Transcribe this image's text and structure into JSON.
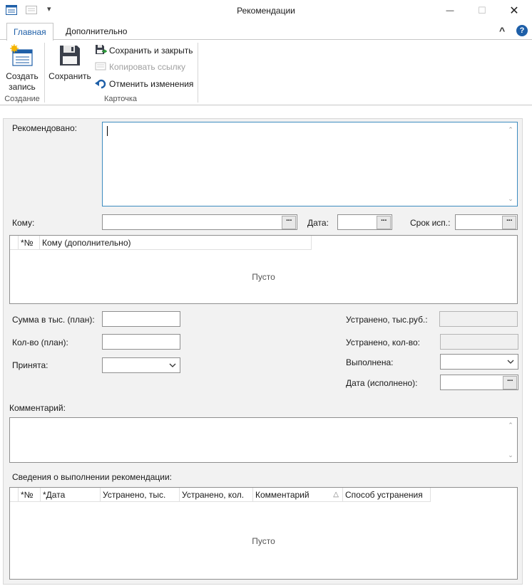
{
  "window": {
    "title": "Рекомендации",
    "minimize_glyph": "—",
    "maximize_glyph": "☐",
    "close_glyph": "✕",
    "qat_dropdown_glyph": "▾"
  },
  "ribbon": {
    "tabs": [
      {
        "label": "Главная",
        "active": true
      },
      {
        "label": "Дополнительно",
        "active": false
      }
    ],
    "collapse_glyph": "^",
    "help_glyph": "?",
    "groups": {
      "create": {
        "label": "Создание",
        "create_button": {
          "line1": "Создать",
          "line2": "запись"
        }
      },
      "card": {
        "label": "Карточка",
        "save_button": "Сохранить",
        "save_close": "Сохранить и закрыть",
        "copy_link": "Копировать ссылку",
        "undo_changes": "Отменить изменения"
      }
    }
  },
  "form": {
    "recommended_label": "Рекомендовано:",
    "recommended_value": "",
    "to_label": "Кому:",
    "to_value": "",
    "date_label": "Дата:",
    "date_value": "",
    "deadline_label": "Срок исп.:",
    "deadline_value": "",
    "dots_glyph": "···",
    "to_extra_grid": {
      "columns": [
        "*№",
        "Кому (дополнительно)"
      ],
      "empty_text": "Пусто"
    },
    "sum_plan_label": "Сумма в тыс. (план):",
    "sum_plan_value": "",
    "qty_plan_label": "Кол-во (план):",
    "qty_plan_value": "",
    "accepted_label": "Принята:",
    "accepted_value": "",
    "fixed_thousand_label": "Устранено, тыс.руб.:",
    "fixed_thousand_value": "",
    "fixed_qty_label": "Устранено, кол-во:",
    "fixed_qty_value": "",
    "done_label": "Выполнена:",
    "done_value": "",
    "done_date_label": "Дата (исполнено):",
    "done_date_value": "",
    "comment_label": "Комментарий:",
    "comment_value": "",
    "execution_label": "Сведения о выполнении рекомендации:",
    "execution_grid": {
      "columns": [
        "*№",
        "*Дата",
        "Устранено, тыс.",
        "Устранено, кол.",
        "Комментарий",
        "Способ устранения"
      ],
      "sort_glyph": "△",
      "empty_text": "Пусто"
    },
    "scroll_up_glyph": "⌃",
    "scroll_down_glyph": "⌄"
  },
  "colors": {
    "accent": "#1e5fa8",
    "focus_border": "#3c8bbf",
    "form_background": "#f2f2f2"
  }
}
